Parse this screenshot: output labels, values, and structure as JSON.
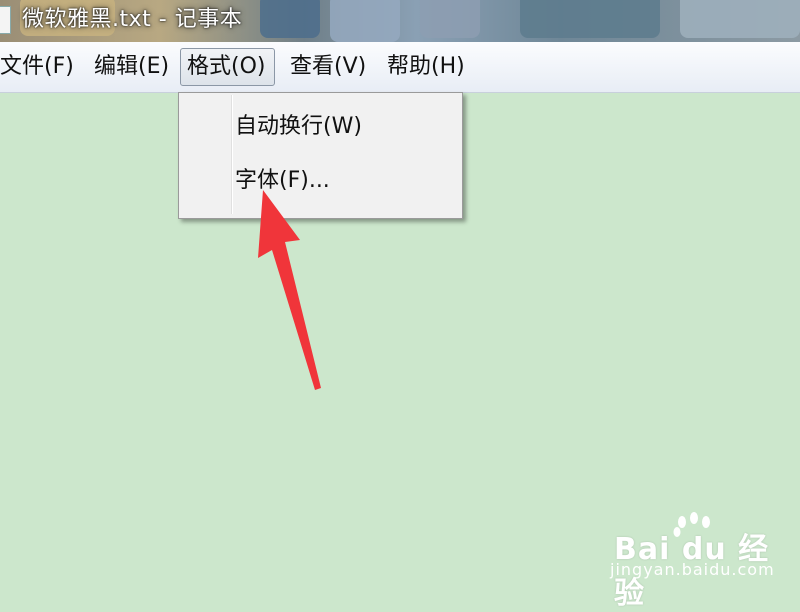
{
  "window": {
    "title": "微软雅黑.txt - 记事本"
  },
  "menubar": {
    "items": [
      {
        "label": "文件(F)"
      },
      {
        "label": "编辑(E)"
      },
      {
        "label": "格式(O)"
      },
      {
        "label": "查看(V)"
      },
      {
        "label": "帮助(H)"
      }
    ]
  },
  "format_menu": {
    "items": [
      {
        "label": "自动换行(W)"
      },
      {
        "label": "字体(F)..."
      }
    ]
  },
  "annotation": {
    "arrow_color": "#f0353a",
    "arrow_points_to": "字体(F)..."
  },
  "watermark": {
    "brand": "Bai du 经验",
    "url": "jingyan.baidu.com"
  },
  "colors": {
    "editor_background": "#cce7cc",
    "menubar_background": "#f2f5fa",
    "dropdown_background": "#f1f1f1"
  }
}
